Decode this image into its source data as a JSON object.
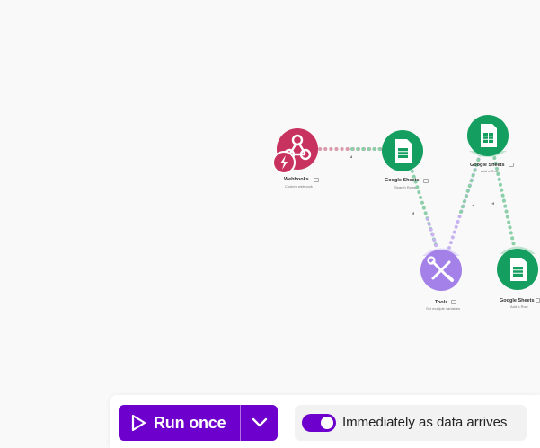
{
  "scenario": {
    "modules": [
      {
        "id": "webhooks",
        "title": "Webhooks",
        "subtitle": "Custom webhook",
        "color": "#c8325f",
        "icon": "webhook-icon",
        "badge": "instant-trigger-icon"
      },
      {
        "id": "sheets_search",
        "title": "Google Sheets",
        "subtitle": "Search Rows",
        "color": "#149e5f",
        "icon": "spreadsheet-icon"
      },
      {
        "id": "tools",
        "title": "Tools",
        "subtitle": "Set multiple variables",
        "color": "#a481e8",
        "icon": "wrench-screwdriver-icon"
      },
      {
        "id": "sheets_add1",
        "title": "Google Sheets",
        "subtitle": "Add a Row",
        "color": "#149e5f",
        "icon": "spreadsheet-icon"
      },
      {
        "id": "sheets_add2",
        "title": "Google Sheets",
        "subtitle": "Add a Row",
        "color": "#149e5f",
        "icon": "spreadsheet-icon"
      }
    ]
  },
  "toolbar": {
    "run_label": "Run once",
    "run_icon": "play-icon",
    "dropdown_icon": "chevron-down-icon",
    "schedule_label": "Immediately as data arrives",
    "schedule_enabled": true,
    "accent": "#6d00cc"
  }
}
